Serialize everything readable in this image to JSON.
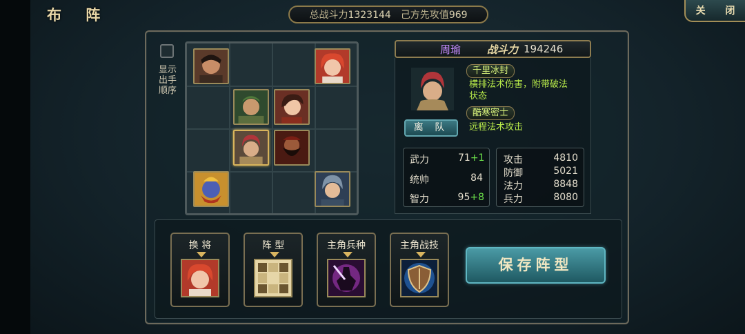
{
  "title": "布 阵",
  "close_label": "关 闭",
  "summary": {
    "total_power_label": "总战斗力",
    "total_power": "1323144",
    "initiative_label": "己方先攻值",
    "initiative": "969"
  },
  "order_toggle": {
    "label": "显示出手顺序",
    "checked": false
  },
  "hero": {
    "name": "周瑜",
    "power_label": "战斗力",
    "power": "194246",
    "skills": [
      {
        "name": "千里冰封",
        "desc": "横排法术伤害，附带破法状态"
      },
      {
        "name": "酷寒密士",
        "desc": "远程法术攻击"
      }
    ],
    "leave_label": "离 队",
    "attributes": [
      {
        "label": "武力",
        "value": "71",
        "bonus": "+1"
      },
      {
        "label": "统帅",
        "value": "84",
        "bonus": ""
      },
      {
        "label": "智力",
        "value": "95",
        "bonus": "+8"
      }
    ],
    "combat_stats": [
      {
        "label": "攻击",
        "value": "4810"
      },
      {
        "label": "防御",
        "value": "5021"
      },
      {
        "label": "法力",
        "value": "8848"
      },
      {
        "label": "兵力",
        "value": "8080"
      }
    ]
  },
  "actions": [
    {
      "label": "换 将",
      "icon": "heroine-portrait-icon"
    },
    {
      "label": "阵 型",
      "icon": "formation-grid-icon"
    },
    {
      "label": "主角兵种",
      "icon": "warrior-class-icon"
    },
    {
      "label": "主角战技",
      "icon": "shield-skill-icon"
    }
  ],
  "save_label": "保存阵型",
  "colors": {
    "accent_gold": "#d9b560",
    "skill_green": "#b9ec4a",
    "hero_name_purple": "#c68bff",
    "button_teal": "#4a9aa5"
  }
}
